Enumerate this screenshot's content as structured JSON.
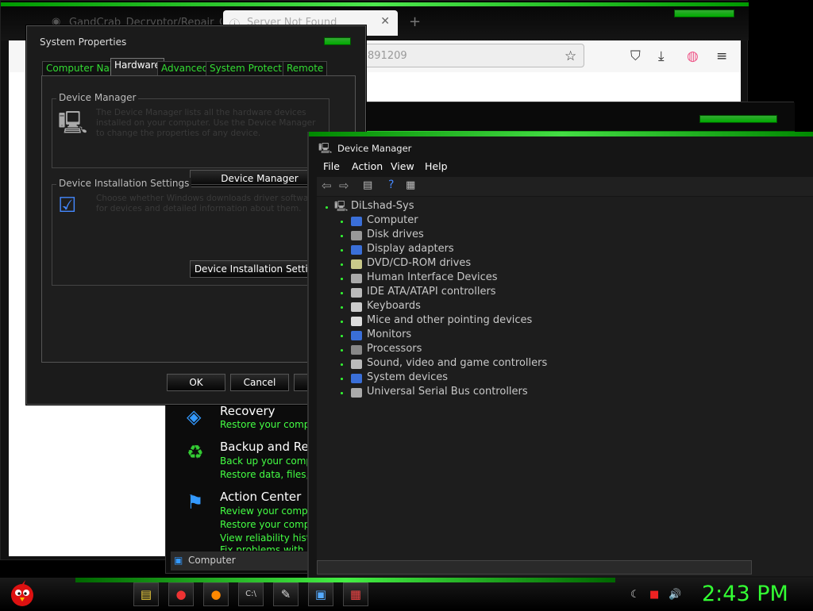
{
  "browser": {
    "tab1_title": "GandCrab_Decryptor/Repair_Gu",
    "tab2_title": "Server Not Found",
    "close_glyph": "✕",
    "new_tab_glyph": "+",
    "url_text": "891209",
    "icons": [
      "star-icon",
      "pocket-icon",
      "download-icon",
      "account-icon",
      "menu-icon"
    ]
  },
  "control_panel": {
    "items": [
      {
        "title": "Recovery",
        "links": [
          "Restore your compu"
        ]
      },
      {
        "title": "Backup and Res",
        "links": [
          "Back up your compu",
          "Restore data, files, or"
        ]
      },
      {
        "title": "Action Center",
        "links": [
          "Review your comput",
          "Restore your comput",
          "View reliability histor",
          "Fix problems with"
        ]
      }
    ],
    "status": "Computer"
  },
  "system_properties": {
    "title": "System Properties",
    "tabs": [
      "Computer Name",
      "Hardware",
      "Advanced",
      "System Protection",
      "Remote"
    ],
    "active_tab": "Hardware",
    "device_manager_group": {
      "label": "Device Manager",
      "description": "The Device Manager lists all the hardware devices installed on your computer. Use the Device Manager to change the properties of any device.",
      "button": "Device Manager"
    },
    "install_group": {
      "label": "Device Installation Settings",
      "description": "Choose whether Windows downloads driver software for devices and detailed information about them.",
      "button": "Device Installation Settings"
    },
    "ok_label": "OK",
    "cancel_label": "Cancel"
  },
  "device_manager": {
    "title": "Device Manager",
    "menu": [
      "File",
      "Action",
      "View",
      "Help"
    ],
    "root": "DiLshad-Sys",
    "devices": [
      {
        "label": "Computer",
        "color": "#3a6fd8"
      },
      {
        "label": "Disk drives",
        "color": "#999999"
      },
      {
        "label": "Display adapters",
        "color": "#3a6fd8"
      },
      {
        "label": "DVD/CD-ROM drives",
        "color": "#c9c98a"
      },
      {
        "label": "Human Interface Devices",
        "color": "#aaaaaa"
      },
      {
        "label": "IDE ATA/ATAPI controllers",
        "color": "#bbbbbb"
      },
      {
        "label": "Keyboards",
        "color": "#cccccc"
      },
      {
        "label": "Mice and other pointing devices",
        "color": "#dddddd"
      },
      {
        "label": "Monitors",
        "color": "#3a6fd8"
      },
      {
        "label": "Processors",
        "color": "#888888"
      },
      {
        "label": "Sound, video and game controllers",
        "color": "#bbbbbb"
      },
      {
        "label": "System devices",
        "color": "#3a6fd8"
      },
      {
        "label": "Universal Serial Bus controllers",
        "color": "#aaaaaa"
      }
    ]
  },
  "taskbar": {
    "clock": "2:43 PM",
    "apps": [
      {
        "name": "explorer-icon",
        "glyph": "▤",
        "color": "#f2d23c"
      },
      {
        "name": "chrome-icon",
        "glyph": "●",
        "color": "#e33"
      },
      {
        "name": "firefox-icon",
        "glyph": "●",
        "color": "#f80"
      },
      {
        "name": "cmd-icon",
        "glyph": "C:\\",
        "color": "#ccc"
      },
      {
        "name": "paint-icon",
        "glyph": "✎",
        "color": "#ddd"
      },
      {
        "name": "system-icon",
        "glyph": "▣",
        "color": "#5af"
      },
      {
        "name": "device-icon",
        "glyph": "▦",
        "color": "#e44"
      }
    ]
  },
  "colors": {
    "accent": "#33ee33",
    "background": "#000000"
  }
}
